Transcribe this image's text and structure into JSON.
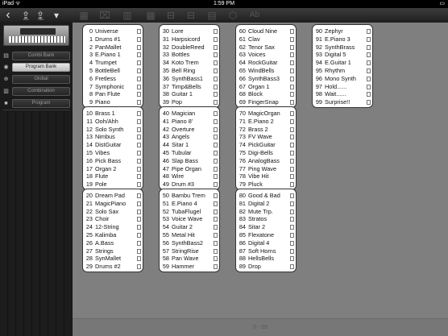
{
  "status": {
    "carrier": "iPad ᯤ",
    "time": "1:59 PM",
    "battery": "▭"
  },
  "toolbar": {
    "back_icon": "‹",
    "buttons": [
      {
        "glyph": "⇪",
        "sub": "ALL"
      },
      {
        "glyph": "⇪",
        "sub": "SEL"
      },
      {
        "glyph": "▾",
        "sub": ""
      }
    ],
    "dim_icons": [
      "▦",
      "⌧",
      "▥",
      "▦",
      "⊟",
      "⊟",
      "▤",
      "⬡",
      "Ab"
    ]
  },
  "sidebar": {
    "combi_bank": "Combi Bank",
    "program_bank": "Program Bank",
    "global": "Global",
    "combination": "Combination",
    "program": "Program"
  },
  "footer": {
    "range": "0 - 99"
  },
  "banks": [
    {
      "rows": [
        {
          "n": "0",
          "name": "Universe"
        },
        {
          "n": "1",
          "name": "Drums #1"
        },
        {
          "n": "2",
          "name": "PanMallet"
        },
        {
          "n": "3",
          "name": "E.Piano 1"
        },
        {
          "n": "4",
          "name": "Trumpet"
        },
        {
          "n": "5",
          "name": "BottleBell"
        },
        {
          "n": "6",
          "name": "Fretless"
        },
        {
          "n": "7",
          "name": "Symphonic"
        },
        {
          "n": "8",
          "name": "Pan Flute"
        },
        {
          "n": "9",
          "name": "Piano"
        }
      ]
    },
    {
      "rows": [
        {
          "n": "30",
          "name": "Lore"
        },
        {
          "n": "31",
          "name": "Harpsicord"
        },
        {
          "n": "32",
          "name": "DoubleReed"
        },
        {
          "n": "33",
          "name": "Bottles"
        },
        {
          "n": "34",
          "name": "Koto Trem"
        },
        {
          "n": "35",
          "name": "Bell Ring"
        },
        {
          "n": "36",
          "name": "SynthBass1"
        },
        {
          "n": "37",
          "name": "Timp&Bells"
        },
        {
          "n": "38",
          "name": "Guitar 1"
        },
        {
          "n": "39",
          "name": "Pop"
        }
      ]
    },
    {
      "rows": [
        {
          "n": "60",
          "name": "Cloud Nine"
        },
        {
          "n": "61",
          "name": "Clav"
        },
        {
          "n": "62",
          "name": "Tenor Sax"
        },
        {
          "n": "63",
          "name": "Voices"
        },
        {
          "n": "64",
          "name": "RockGuitar"
        },
        {
          "n": "65",
          "name": "WindBells"
        },
        {
          "n": "66",
          "name": "SynthBass3"
        },
        {
          "n": "67",
          "name": "Organ 1"
        },
        {
          "n": "68",
          "name": "Block"
        },
        {
          "n": "69",
          "name": "FingerSnap"
        }
      ]
    },
    {
      "rows": [
        {
          "n": "90",
          "name": "Zephyr"
        },
        {
          "n": "91",
          "name": "E.Piano 3"
        },
        {
          "n": "92",
          "name": "SynthBrass"
        },
        {
          "n": "93",
          "name": "Digital 5"
        },
        {
          "n": "94",
          "name": "E.Guitar 1"
        },
        {
          "n": "95",
          "name": "Rhythm"
        },
        {
          "n": "96",
          "name": "Mono Synth"
        },
        {
          "n": "97",
          "name": "Hold......"
        },
        {
          "n": "98",
          "name": "Wait......"
        },
        {
          "n": "99",
          "name": "Surprise!!"
        }
      ]
    },
    {
      "rows": [
        {
          "n": "10",
          "name": "Brass 1"
        },
        {
          "n": "11",
          "name": "Ooh/Ahh"
        },
        {
          "n": "12",
          "name": "Solo Synth"
        },
        {
          "n": "13",
          "name": "Nimbus"
        },
        {
          "n": "14",
          "name": "DistGuitar"
        },
        {
          "n": "15",
          "name": "Vibes"
        },
        {
          "n": "16",
          "name": "Pick Bass"
        },
        {
          "n": "17",
          "name": "Organ 2"
        },
        {
          "n": "18",
          "name": "Flute"
        },
        {
          "n": "19",
          "name": "Pole"
        }
      ]
    },
    {
      "rows": [
        {
          "n": "40",
          "name": "Magician"
        },
        {
          "n": "41",
          "name": "Piano 8'"
        },
        {
          "n": "42",
          "name": "Overture"
        },
        {
          "n": "43",
          "name": "Angels"
        },
        {
          "n": "44",
          "name": "Sitar 1"
        },
        {
          "n": "45",
          "name": "Tubular"
        },
        {
          "n": "46",
          "name": "Slap Bass"
        },
        {
          "n": "47",
          "name": "Pipe Organ"
        },
        {
          "n": "48",
          "name": "Wire"
        },
        {
          "n": "49",
          "name": "Drum #3"
        }
      ]
    },
    {
      "rows": [
        {
          "n": "70",
          "name": "MagicOrgan"
        },
        {
          "n": "71",
          "name": "E.Piano 2"
        },
        {
          "n": "72",
          "name": "Brass 2"
        },
        {
          "n": "73",
          "name": "FV Wave"
        },
        {
          "n": "74",
          "name": "PickGuitar"
        },
        {
          "n": "75",
          "name": "Digi-Bells"
        },
        {
          "n": "76",
          "name": "AnalogBass"
        },
        {
          "n": "77",
          "name": "Ping Wave"
        },
        {
          "n": "78",
          "name": "Vibe Hit"
        },
        {
          "n": "79",
          "name": "Pluck"
        }
      ]
    },
    {
      "rows": [
        {
          "n": "20",
          "name": "Dream Pad"
        },
        {
          "n": "21",
          "name": "MagicPiano"
        },
        {
          "n": "22",
          "name": "Solo Sax"
        },
        {
          "n": "23",
          "name": "Choir"
        },
        {
          "n": "24",
          "name": "12-String"
        },
        {
          "n": "25",
          "name": "Kalimba"
        },
        {
          "n": "26",
          "name": "A.Bass"
        },
        {
          "n": "27",
          "name": "Strings"
        },
        {
          "n": "28",
          "name": "SynMallet"
        },
        {
          "n": "29",
          "name": "Drums #2"
        }
      ]
    },
    {
      "rows": [
        {
          "n": "50",
          "name": "Bambu Trem"
        },
        {
          "n": "51",
          "name": "E.Piano 4"
        },
        {
          "n": "52",
          "name": "TubaFlugel"
        },
        {
          "n": "53",
          "name": "Voice Wave"
        },
        {
          "n": "54",
          "name": "Guitar 2"
        },
        {
          "n": "55",
          "name": "Metal Hit"
        },
        {
          "n": "56",
          "name": "SynthBass2"
        },
        {
          "n": "57",
          "name": "StringRise"
        },
        {
          "n": "58",
          "name": "Pan Wave"
        },
        {
          "n": "59",
          "name": "Hammer"
        }
      ]
    },
    {
      "rows": [
        {
          "n": "80",
          "name": "Good & Bad"
        },
        {
          "n": "81",
          "name": "Digital 2"
        },
        {
          "n": "82",
          "name": "Mute Trp."
        },
        {
          "n": "83",
          "name": "Stratos"
        },
        {
          "n": "84",
          "name": "Sitar 2"
        },
        {
          "n": "85",
          "name": "Flexatone"
        },
        {
          "n": "86",
          "name": "Digital 4"
        },
        {
          "n": "87",
          "name": "Soft Horns"
        },
        {
          "n": "88",
          "name": "HellsBells"
        },
        {
          "n": "89",
          "name": "Drop"
        }
      ]
    }
  ]
}
